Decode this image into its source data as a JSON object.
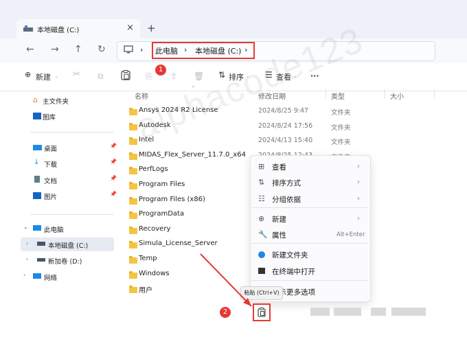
{
  "window": {
    "tab_title": "本地磁盘 (C:)",
    "tab_close": "×",
    "tab_new": "+"
  },
  "nav": {
    "back": "←",
    "forward": "→",
    "up": "↑",
    "refresh": "↻"
  },
  "address": {
    "crumb_this_pc": "此电脑",
    "sep1": "›",
    "crumb_c": "本地磁盘 (C:)",
    "sep2": "›",
    "chevron_start": "›"
  },
  "toolbar": {
    "new_label": "新建",
    "sort_label": "排序",
    "view_label": "查看",
    "more": "···",
    "badge1": "1"
  },
  "sidebar": {
    "items": [
      {
        "label": "主文件夹"
      },
      {
        "label": "图库"
      },
      {
        "label": "桌面"
      },
      {
        "label": "下载"
      },
      {
        "label": "文档"
      },
      {
        "label": "图片"
      },
      {
        "label": "此电脑"
      },
      {
        "label": "本地磁盘 (C:)"
      },
      {
        "label": "新加卷 (D:)"
      },
      {
        "label": "网络"
      }
    ]
  },
  "columns": {
    "name": "名称",
    "date": "修改日期",
    "type": "类型",
    "size": "大小"
  },
  "files": [
    {
      "name": "Ansys 2024 R2 License",
      "date": "2024/8/25 9:47",
      "type": "文件夹"
    },
    {
      "name": "Autodesk",
      "date": "2024/8/24 17:56",
      "type": "文件夹"
    },
    {
      "name": "Intel",
      "date": "2024/4/13 15:40",
      "type": "文件夹"
    },
    {
      "name": "MIDAS_Flex_Server_11.7.0_x64",
      "date": "2024/8/25 12:43",
      "type": "文件夹"
    },
    {
      "name": "PerfLogs",
      "date": "",
      "type": ""
    },
    {
      "name": "Program Files",
      "date": "",
      "type": ""
    },
    {
      "name": "Program Files (x86)",
      "date": "",
      "type": ""
    },
    {
      "name": "ProgramData",
      "date": "",
      "type": ""
    },
    {
      "name": "Recovery",
      "date": "",
      "type": ""
    },
    {
      "name": "Simula_License_Server",
      "date": "",
      "type": ""
    },
    {
      "name": "Temp",
      "date": "",
      "type": ""
    },
    {
      "name": "Windows",
      "date": "",
      "type": ""
    },
    {
      "name": "用户",
      "date": "",
      "type": ""
    }
  ],
  "context_menu": {
    "view": "查看",
    "sort": "排序方式",
    "group": "分组依据",
    "new": "新建",
    "properties": "属性",
    "properties_shortcut": "Alt+Enter",
    "new_folder": "新建文件夹",
    "open_terminal": "在终端中打开",
    "more_options": "显示更多选项"
  },
  "tooltip": {
    "paste": "粘贴 (Ctrl+V)"
  },
  "annotations": {
    "badge2": "2"
  },
  "watermark": "alphacode123",
  "colors": {
    "accent_red": "#e53935",
    "folder_yellow": "#f4c542",
    "selected_bg": "#e6ebf3"
  }
}
